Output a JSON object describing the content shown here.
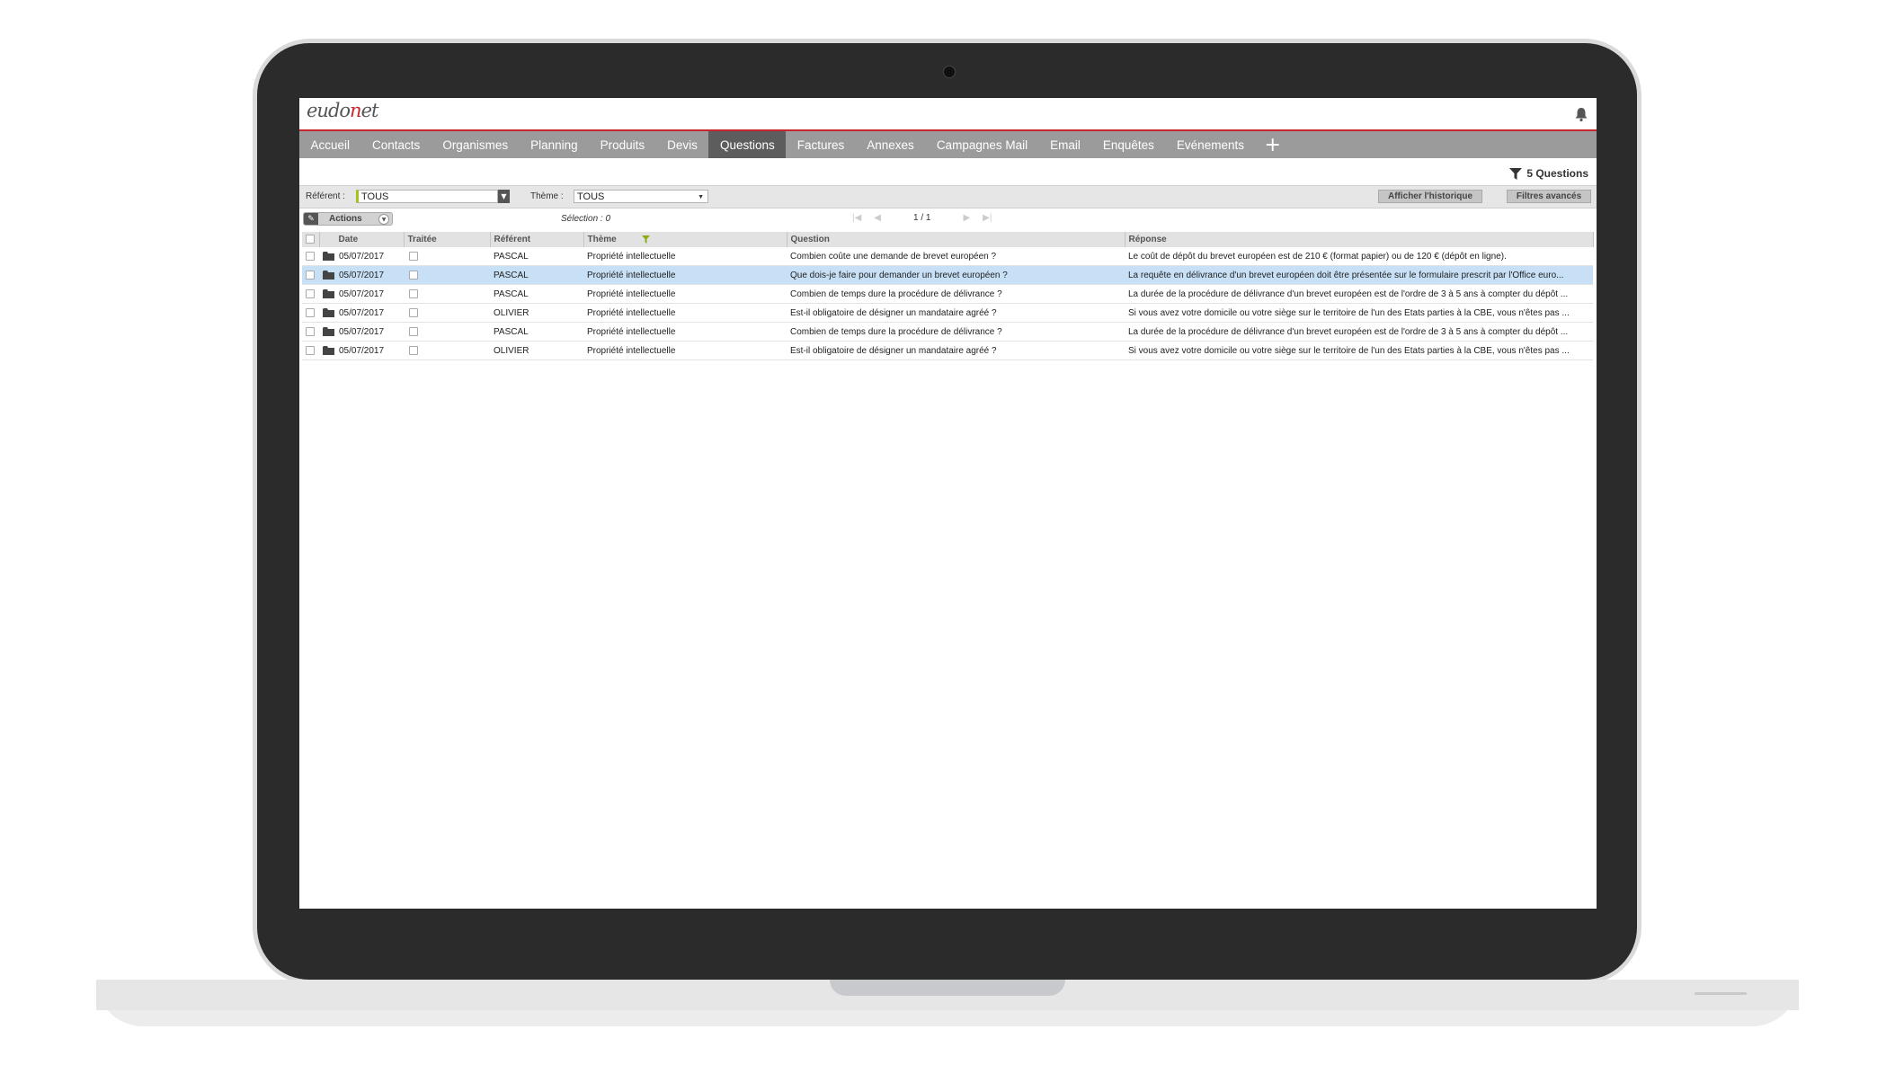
{
  "app": {
    "logo_text_1": "eudo",
    "logo_text_2": "net",
    "accent": "#c9252c"
  },
  "nav": {
    "tabs": [
      {
        "label": "Accueil"
      },
      {
        "label": "Contacts"
      },
      {
        "label": "Organismes"
      },
      {
        "label": "Planning"
      },
      {
        "label": "Produits"
      },
      {
        "label": "Devis"
      },
      {
        "label": "Questions",
        "active": true
      },
      {
        "label": "Factures"
      },
      {
        "label": "Annexes"
      },
      {
        "label": "Campagnes Mail"
      },
      {
        "label": "Email"
      },
      {
        "label": "Enquêtes"
      },
      {
        "label": "Evénements"
      }
    ],
    "add_label": "+"
  },
  "count_label": "5 Questions",
  "filters": {
    "referent_label": "Référent :",
    "referent_value": "TOUS",
    "theme_label": "Thème :",
    "theme_value": "TOUS",
    "history_button": "Afficher l'historique",
    "advanced_button": "Filtres avancés"
  },
  "toolbar": {
    "actions_label": "Actions",
    "selection_text": "Sélection : 0",
    "page_text": "1 / 1"
  },
  "table": {
    "columns": [
      "Date",
      "Traitée",
      "Référent",
      "Thème",
      "Question",
      "Réponse"
    ],
    "rows": [
      {
        "date": "05/07/2017",
        "referent": "PASCAL",
        "theme": "Propriété intellectuelle",
        "question": "Combien coûte une demande de brevet européen ?",
        "reponse": "Le coût de dépôt du brevet européen est de 210 € (format papier) ou de 120 € (dépôt en ligne)."
      },
      {
        "date": "05/07/2017",
        "referent": "PASCAL",
        "theme": "Propriété intellectuelle",
        "question": "Que dois-je faire pour demander un brevet européen ?",
        "reponse": "La requête en délivrance d'un brevet européen doit être présentée sur le formulaire prescrit par l'Office euro..."
      },
      {
        "date": "05/07/2017",
        "referent": "PASCAL",
        "theme": "Propriété intellectuelle",
        "question": "Combien de temps dure la procédure de délivrance ?",
        "reponse": "La durée de la procédure de délivrance d'un brevet européen est de l'ordre de 3 à 5 ans à compter du dépôt ..."
      },
      {
        "date": "05/07/2017",
        "referent": "OLIVIER",
        "theme": "Propriété intellectuelle",
        "question": "Est-il obligatoire de désigner un mandataire agréé ?",
        "reponse": "Si vous avez votre domicile ou votre siège sur le territoire de l'un des Etats parties à la CBE, vous n'êtes pas ..."
      },
      {
        "date": "05/07/2017",
        "referent": "PASCAL",
        "theme": "Propriété intellectuelle",
        "question": "Combien de temps dure la procédure de délivrance ?",
        "reponse": "La durée de la procédure de délivrance d'un brevet européen est de l'ordre de 3 à 5 ans à compter du dépôt ..."
      },
      {
        "date": "05/07/2017",
        "referent": "OLIVIER",
        "theme": "Propriété intellectuelle",
        "question": "Est-il obligatoire de désigner un mandataire agréé ?",
        "reponse": "Si vous avez votre domicile ou votre siège sur le territoire de l'un des Etats parties à la CBE, vous n'êtes pas ..."
      }
    ],
    "selected_row": 1
  },
  "icons": {
    "bell": "bell-icon",
    "filter": "filter-icon",
    "folder": "folder-icon"
  }
}
